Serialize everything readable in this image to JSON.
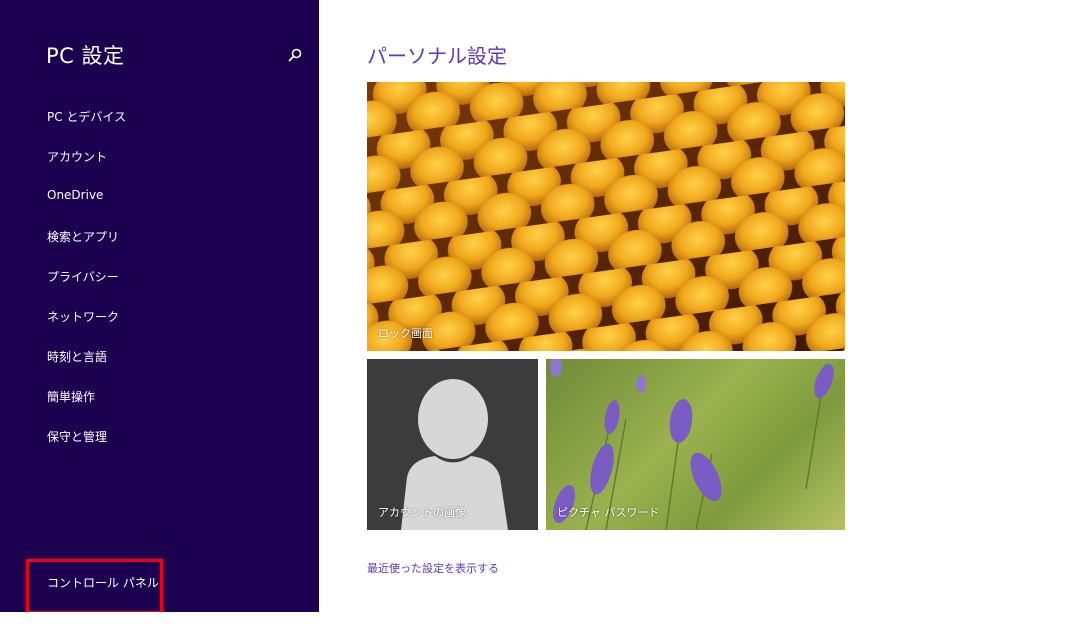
{
  "sidebar": {
    "title": "PC 設定",
    "search_icon": "search-icon",
    "items": [
      {
        "label": "PC とデバイス"
      },
      {
        "label": "アカウント"
      },
      {
        "label": "OneDrive"
      },
      {
        "label": "検索とアプリ"
      },
      {
        "label": "プライバシー"
      },
      {
        "label": "ネットワーク"
      },
      {
        "label": "時刻と言語"
      },
      {
        "label": "簡単操作"
      },
      {
        "label": "保守と管理"
      }
    ],
    "control_panel_label": "コントロール パネル"
  },
  "main": {
    "title": "パーソナル設定",
    "tiles": {
      "lock_screen": "ロック画面",
      "account_picture": "アカウントの画像",
      "picture_password": "ピクチャ パスワード"
    },
    "recent_link": "最近使った設定を表示する"
  },
  "colors": {
    "sidebar_bg": "#1c0150",
    "accent": "#5a3ab8",
    "highlight": "#e8001a"
  }
}
